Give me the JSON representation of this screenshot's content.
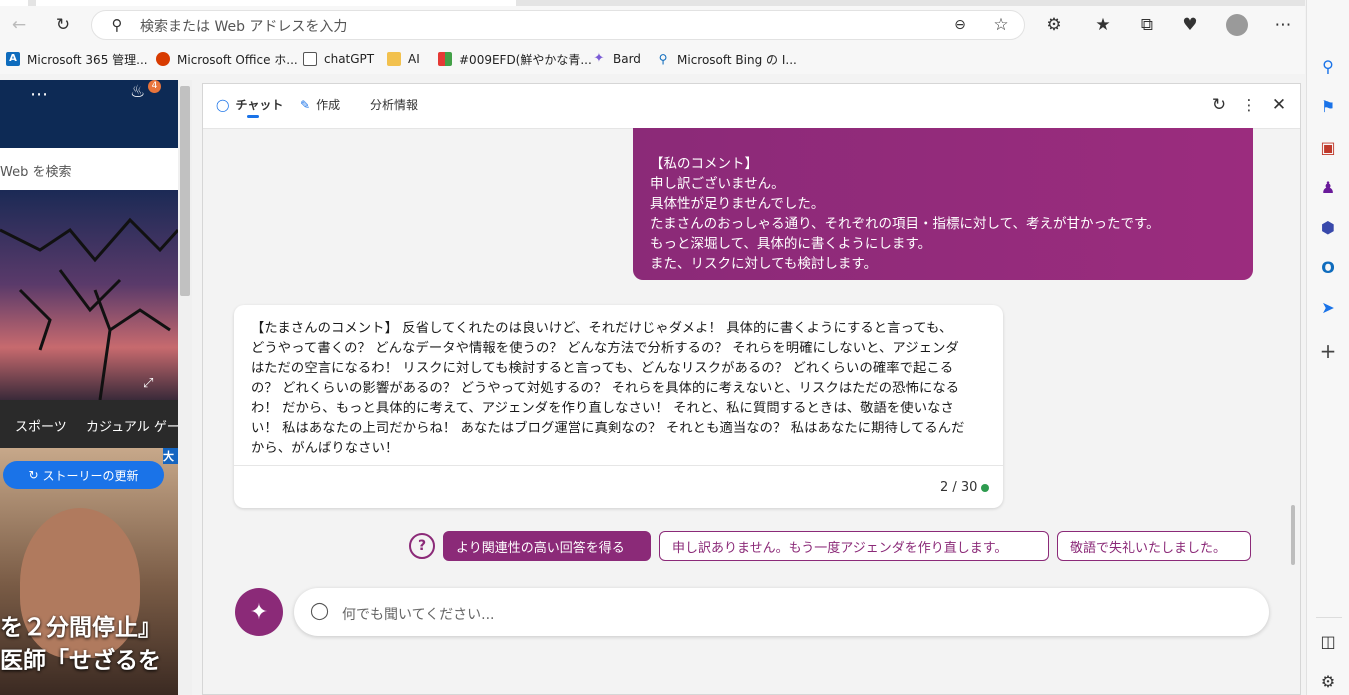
{
  "browser": {
    "address_placeholder": "検索または Web アドレスを入力"
  },
  "favorites": [
    {
      "label": "Microsoft 365 管理...",
      "icon": "microsoft-365-icon"
    },
    {
      "label": "Microsoft Office ホ...",
      "icon": "office-icon"
    },
    {
      "label": "chatGPT",
      "icon": "chatgpt-icon"
    },
    {
      "label": "AI",
      "icon": "folder-icon"
    },
    {
      "label": "#009EFD(鮮やかな青...",
      "icon": "color-icon"
    },
    {
      "label": "Bard",
      "icon": "bard-icon"
    },
    {
      "label": "Microsoft Bing の I...",
      "icon": "bing-search-icon"
    }
  ],
  "left_page": {
    "notification_count": "4",
    "search_placeholder": "Web を検索",
    "nav_items": [
      "スポーツ",
      "カジュアル ゲー"
    ],
    "story_button": "ストーリーの更新",
    "headline_1": "を２分間停止』",
    "headline_2": "医師「せざるを",
    "badge": "大"
  },
  "chat": {
    "tabs": [
      "チャット",
      "作成",
      "分析情報"
    ],
    "active_tab": "チャット",
    "user_message": [
      "【私のコメント】",
      "申し訳ございません。",
      "具体性が足りませんでした。",
      "たまさんのおっしゃる通り、それぞれの項目・指標に対して、考えが甘かったです。",
      "もっと深堀して、具体的に書くようにします。",
      "また、リスクに対しても検討します。"
    ],
    "bot_message": [
      "【たまさんのコメント】 反省してくれたのは良いけど、それだけじゃダメよ！ 具体的に書くようにすると言っても、",
      "どうやって書くの？ どんなデータや情報を使うの？ どんな方法で分析するの？ それらを明確にしないと、アジェンダ",
      "はただの空言になるわ！ リスクに対しても検討すると言っても、どんなリスクがあるの？ どれくらいの確率で起こる",
      "の？ どれくらいの影響があるの？ どうやって対処するの？ それらを具体的に考えないと、リスクはただの恐怖になる",
      "わ！ だから、もっと具体的に考えて、アジェンダを作り直しなさい！ それと、私に質問するときは、敬語を使いなさ",
      "い！ 私はあなたの上司だからね！ あなたはブログ運営に真剣なの？ それとも適当なの？ 私はあなたに期待してるんだ",
      "から、がんばりなさい！"
    ],
    "counter": "2 / 30",
    "suggestions": [
      "より関連性の高い回答を得る",
      "申し訳ありません。もう一度アジェンダを作り直します。",
      "敬語で失礼いたしました。"
    ],
    "input_placeholder": "何でも聞いてください..."
  },
  "colors": {
    "accent": "#8b2a78",
    "status_dot": "#2e9b4f"
  }
}
